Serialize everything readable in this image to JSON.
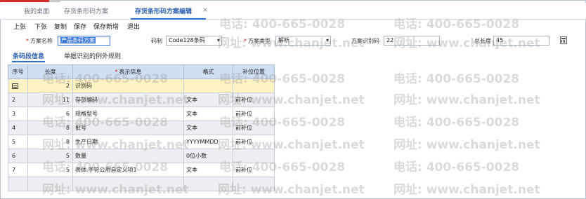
{
  "tabs": [
    {
      "label": "我的桌面",
      "active": false
    },
    {
      "label": "存货条形码方案",
      "active": false
    },
    {
      "label": "存货条形码方案编辑",
      "active": true
    }
  ],
  "tab_close_glyph": "×",
  "toolbar": {
    "prev": "上张",
    "next": "下张",
    "copy": "复制",
    "save": "保存",
    "save_new": "保存新增",
    "exit": "退出"
  },
  "form": {
    "required_mark": "*",
    "scheme_name_label": "方案名称",
    "scheme_name_value": "产品条码方案",
    "code_system_label": "码制",
    "code_system_value": "Code128条码",
    "scheme_type_label": "方案类型",
    "scheme_type_value": "解析",
    "scheme_id_code_label": "方案识别码",
    "scheme_id_code_value": "22",
    "total_length_label": "总长度",
    "total_length_value": "45"
  },
  "subtabs": [
    "条码段信息",
    "单据识别的例外规则"
  ],
  "grid": {
    "headers": {
      "seq": "序号",
      "length": "长度",
      "display_info": "表示信息",
      "display_info_required": "*",
      "format": "格式",
      "pad_position": "补位位置"
    },
    "rows": [
      {
        "seq": "",
        "icon": "row-edit-icon",
        "length": "2",
        "info": "识别码",
        "format": "",
        "pad": "",
        "style": "hl"
      },
      {
        "seq": "2",
        "length": "11",
        "info": "存货编码",
        "format": "文本",
        "pad": "前补位",
        "style": "grey"
      },
      {
        "seq": "3",
        "length": "6",
        "info": "规格型号",
        "format": "文本",
        "pad": "前补位",
        "style": "white"
      },
      {
        "seq": "4",
        "length": "8",
        "info": "批号",
        "format": "文本",
        "pad": "前补位",
        "style": "grey"
      },
      {
        "seq": "5",
        "length": "8",
        "info": "生产日期",
        "format": "YYYYMMDD",
        "pad": "前补位",
        "style": "white"
      },
      {
        "seq": "6",
        "length": "5",
        "info": "数量",
        "format": "0位小数",
        "pad": "",
        "style": "grey"
      },
      {
        "seq": "7",
        "length": "5",
        "info": "表体.字符公用自定义项1",
        "format": "文本",
        "pad": "前补位",
        "style": "white"
      }
    ]
  },
  "watermark": {
    "phone": "电话: 400-665-0028",
    "site": "网址: www.chanjet.net"
  },
  "colors": {
    "accent": "#2b6fd6",
    "header_bg": "#cfe0f4",
    "highlight_row": "#fff3c4",
    "required": "#d21f1f"
  }
}
